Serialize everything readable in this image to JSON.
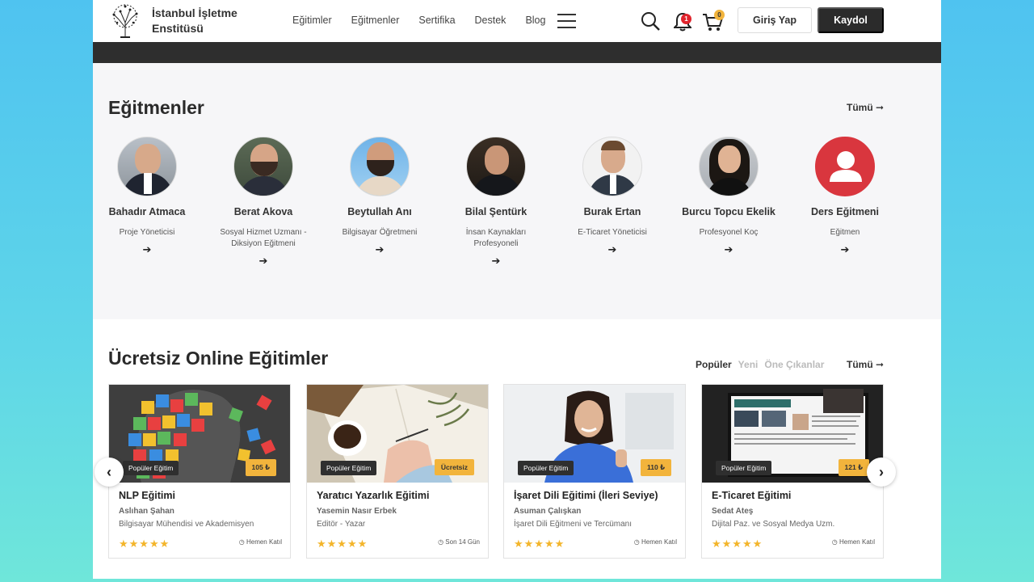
{
  "header": {
    "brand_line1": "İstanbul İşletme",
    "brand_line2": "Enstitüsü",
    "nav": [
      "Eğitimler",
      "Eğitmenler",
      "Sertifika",
      "Destek",
      "Blog"
    ],
    "notifications_count": "1",
    "cart_count": "0",
    "login_label": "Giriş Yap",
    "register_label": "Kaydol"
  },
  "instructors": {
    "title": "Eğitmenler",
    "all_label": "Tümü ➞",
    "items": [
      {
        "name": "Bahadır Atmaca",
        "role": "Proje Yöneticisi",
        "arrow": "➔"
      },
      {
        "name": "Berat Akova",
        "role": "Sosyal Hizmet Uzmanı - Diksiyon Eğitmeni",
        "arrow": "➔"
      },
      {
        "name": "Beytullah Anı",
        "role": "Bilgisayar Öğretmeni",
        "arrow": "➔"
      },
      {
        "name": "Bilal Şentürk",
        "role": "İnsan Kaynakları Profesyoneli",
        "arrow": "➔"
      },
      {
        "name": "Burak Ertan",
        "role": "E-Ticaret Yöneticisi",
        "arrow": "➔"
      },
      {
        "name": "Burcu Topcu Ekelik",
        "role": "Profesyonel Koç",
        "arrow": "➔"
      },
      {
        "name": "Ders Eğitmeni",
        "role": "Eğitmen",
        "arrow": "➔"
      }
    ]
  },
  "courses": {
    "title": "Ücretsiz Online Eğitimler",
    "tabs": [
      "Popüler",
      "Yeni",
      "Öne Çıkanlar"
    ],
    "all_label": "Tümü ➞",
    "items": [
      {
        "title": "NLP Eğitimi",
        "author": "Aslıhan Şahan",
        "role": "Bilgisayar Mühendisi ve Akademisyen",
        "tag": "Popüler Eğitim",
        "price": "105 ₺",
        "meta": "Hemen Katıl",
        "stars": "★★★★★",
        "meta_icon": "clock-icon"
      },
      {
        "title": "Yaratıcı Yazarlık Eğitimi",
        "author": "Yasemin Nasır Erbek",
        "role": "Editör - Yazar",
        "tag": "Popüler Eğitim",
        "price": "Ücretsiz",
        "meta": "Son 14 Gün",
        "stars": "★★★★★",
        "meta_icon": "clock-icon"
      },
      {
        "title": "İşaret Dili Eğitimi (İleri Seviye)",
        "author": "Asuman Çalışkan",
        "role": "İşaret Dili Eğitmeni ve Tercümanı",
        "tag": "Popüler Eğitim",
        "price": "110 ₺",
        "meta": "Hemen Katıl",
        "stars": "★★★★★",
        "meta_icon": "clock-icon"
      },
      {
        "title": "E-Ticaret Eğitimi",
        "author": "Sedat Ateş",
        "role": "Dijital Paz. ve Sosyal Medya Uzm.",
        "tag": "Popüler Eğitim",
        "price": "121 ₺",
        "meta": "Hemen Katıl",
        "stars": "★★★★★",
        "meta_icon": "clock-icon"
      }
    ]
  },
  "carousel": {
    "prev": "‹",
    "next": "›"
  },
  "colors": {
    "accent_dark": "#2b2b2b",
    "price_tag": "#f2b43c",
    "star": "#f3b52b",
    "badge_red": "#e0242c"
  }
}
